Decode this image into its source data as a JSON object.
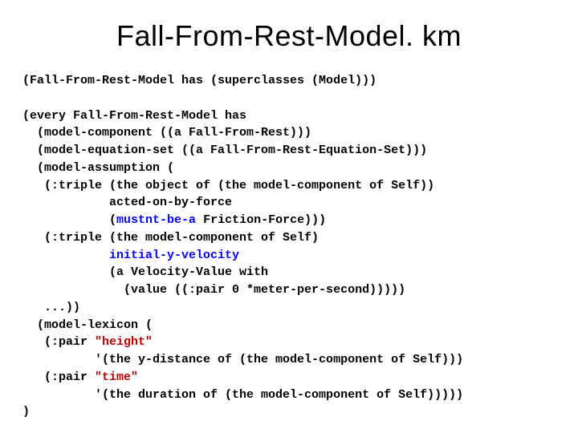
{
  "title": "Fall-From-Rest-Model. km",
  "code": {
    "l01": "(Fall-From-Rest-Model has (superclasses (Model)))",
    "l02": "(every Fall-From-Rest-Model has",
    "l03": "  (model-component ((a Fall-From-Rest)))",
    "l04": "  (model-equation-set ((a Fall-From-Rest-Equation-Set)))",
    "l05": "  (model-assumption (",
    "l06a": "   (:triple (the object of (the model-component of Self))",
    "l06b": "            acted-on-by-force",
    "l06c": "            (",
    "mustnt": "mustnt-be-a",
    "l06d": " Friction-Force)))",
    "l07a": "   (:triple (the model-component of Self)",
    "l07b": "            ",
    "initv": "initial-y-velocity",
    "l07c": "            (a Velocity-Value with",
    "l07d": "              (value ((:pair 0 *meter-per-second)))))",
    "l08": "   ...))",
    "l09": "  (model-lexicon (",
    "l10a": "   (:pair ",
    "h": "\"height\"",
    "l10b": "          '(the y-distance of (the model-component of Self)))",
    "l11a": "   (:pair ",
    "t": "\"time\"",
    "l11b": "          '(the duration of (the model-component of Self)))))",
    "l12": ")"
  }
}
